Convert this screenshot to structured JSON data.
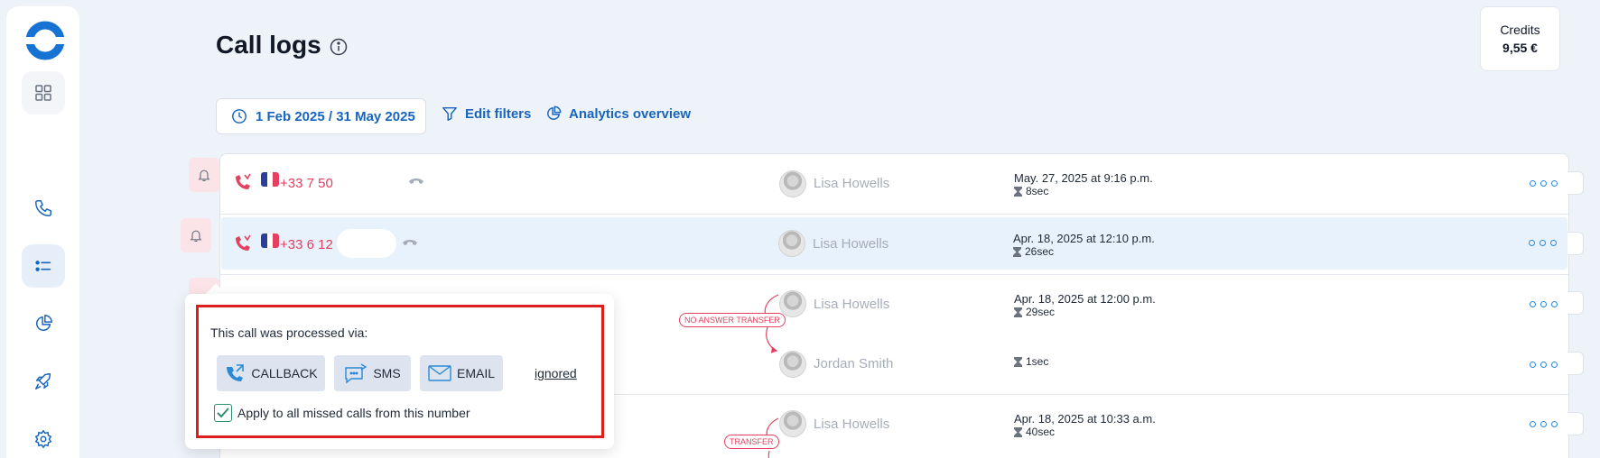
{
  "page": {
    "title": "Call logs"
  },
  "credits": {
    "label": "Credits",
    "value": "9,55 €"
  },
  "filters": {
    "date_range": "1 Feb 2025 / 31 May 2025",
    "edit_filters": "Edit filters",
    "analytics": "Analytics overview"
  },
  "calls": [
    {
      "number": "+33 7 50",
      "agent": "Lisa Howells",
      "date": "May. 27, 2025 at 9:16 p.m.",
      "duration": "8sec"
    },
    {
      "number": "+33 6 12",
      "agent": "Lisa Howells",
      "date": "Apr. 18, 2025 at 12:10 p.m.",
      "duration": "26sec"
    },
    {
      "agent": "Lisa Howells",
      "date": "Apr. 18, 2025 at 12:00 p.m.",
      "duration": "29sec",
      "tag": "NO ANSWER TRANSFER",
      "transfer_agent": "Jordan Smith",
      "transfer_duration": "1sec"
    },
    {
      "agent": "Lisa Howells",
      "date": "Apr. 18, 2025 at 10:33 a.m.",
      "duration": "40sec",
      "tag": "TRANSFER"
    }
  ],
  "popup": {
    "title": "This call was processed via:",
    "callback": "CALLBACK",
    "sms": "SMS",
    "email": "EMAIL",
    "ignored": "ignored",
    "apply_all": "Apply to all missed calls from this number"
  },
  "colors": {
    "accent": "#1765bf",
    "missed": "#e5405f",
    "highlight_row": "#e7f2fc",
    "popup_border": "#dc1e1e",
    "check": "#2f8f72"
  },
  "icons": {
    "sidebar": [
      "logo-icon",
      "dashboard-icon",
      "phone-icon",
      "call-log-list-icon",
      "analytics-pie-icon",
      "rocket-icon",
      "settings-gear-icon"
    ],
    "filters": [
      "clock-icon",
      "filter-icon",
      "pie-chart-icon"
    ],
    "rows": [
      "missed-call-icon",
      "france-flag-icon",
      "hang-up-icon",
      "bell-icon",
      "hourglass-icon",
      "more-options-icon"
    ],
    "popup": [
      "callback-icon",
      "sms-icon",
      "email-icon",
      "checkmark-icon"
    ]
  }
}
